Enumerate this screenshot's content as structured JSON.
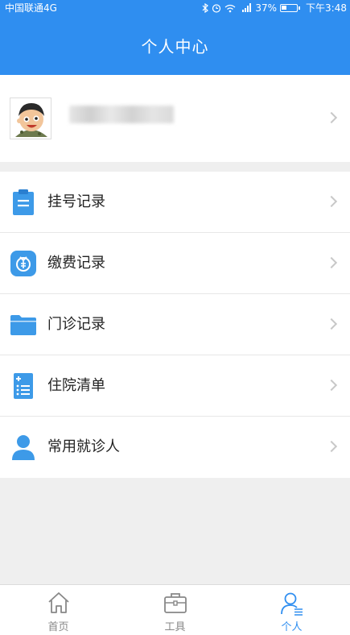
{
  "status_bar": {
    "carrier": "中国联通4G",
    "battery": "37%",
    "battery_level": 0.37,
    "time": "下午3:48"
  },
  "header": {
    "title": "个人中心"
  },
  "menu": {
    "items": [
      {
        "label": "挂号记录",
        "icon": "clipboard-icon"
      },
      {
        "label": "缴费记录",
        "icon": "payment-icon"
      },
      {
        "label": "门诊记录",
        "icon": "folder-icon"
      },
      {
        "label": "住院清单",
        "icon": "list-calc-icon"
      },
      {
        "label": "常用就诊人",
        "icon": "person-icon"
      }
    ]
  },
  "tabbar": {
    "tabs": [
      {
        "label": "首页",
        "icon": "home-icon"
      },
      {
        "label": "工具",
        "icon": "toolbox-icon"
      },
      {
        "label": "个人",
        "icon": "user-icon",
        "active": true
      }
    ]
  },
  "colors": {
    "primary": "#2f8ef0",
    "icon_blue": "#3d9ae8",
    "background": "#efefef"
  }
}
